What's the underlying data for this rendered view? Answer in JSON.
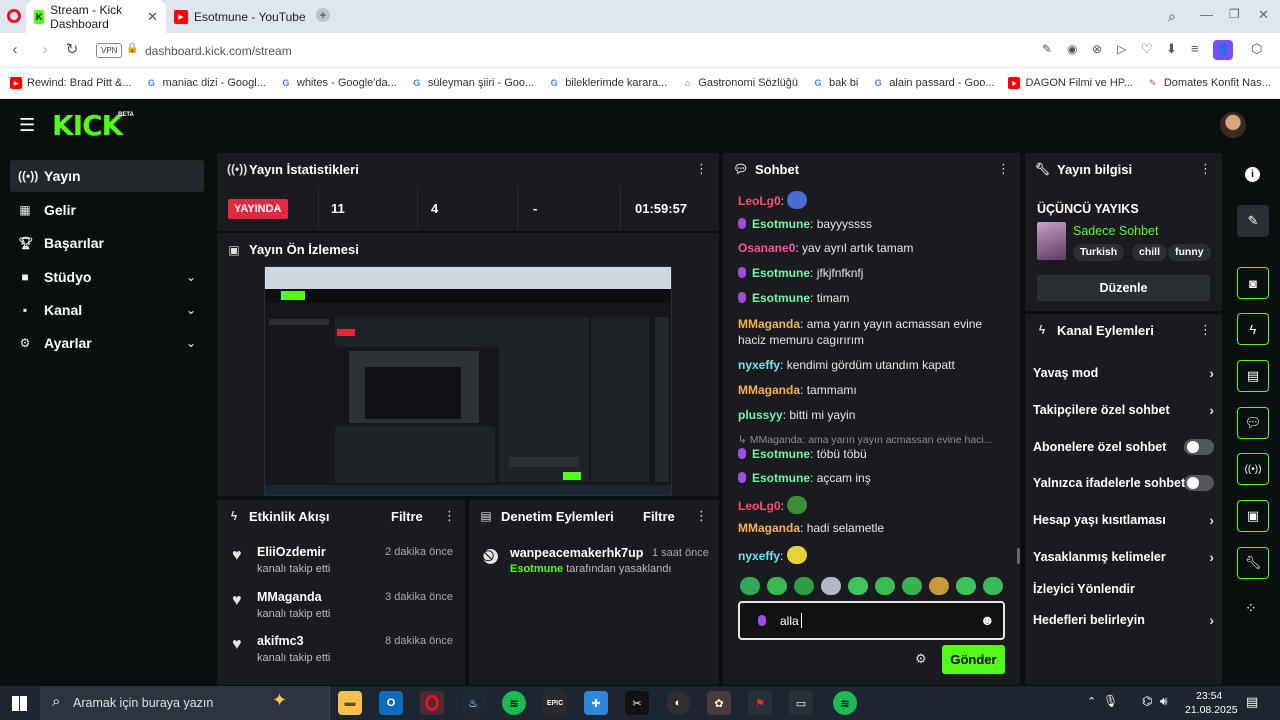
{
  "browser": {
    "tabs": [
      {
        "label": "Stream - Kick Dashboard",
        "active": true
      },
      {
        "label": "Esotmune - YouTube",
        "active": false
      }
    ],
    "url_vpn": "VPN",
    "url": "dashboard.kick.com/stream",
    "bookmarks": [
      {
        "label": "Rewind: Brad Pitt &..."
      },
      {
        "label": "maniac dizi - Googl..."
      },
      {
        "label": "whites - Google'da..."
      },
      {
        "label": "süleyman şiiri - Goo..."
      },
      {
        "label": "bileklerimde karara..."
      },
      {
        "label": "Gastronomi Sözlüğü"
      },
      {
        "label": "bak bi"
      },
      {
        "label": "alain passard - Goo..."
      },
      {
        "label": "DAGON Filmi ve HP..."
      },
      {
        "label": "Domates Konfit Nas..."
      }
    ]
  },
  "kick": {
    "logo": "KICK",
    "beta": "BETA",
    "sidebar": [
      {
        "label": "Yayın",
        "icon": "broadcast-icon",
        "active": true,
        "chevron": false
      },
      {
        "label": "Gelir",
        "icon": "chart-icon",
        "active": false,
        "chevron": false
      },
      {
        "label": "Başarılar",
        "icon": "trophy-icon",
        "active": false,
        "chevron": false
      },
      {
        "label": "Stüdyo",
        "icon": "camera-icon",
        "active": false,
        "chevron": true
      },
      {
        "label": "Kanal",
        "icon": "channel-icon",
        "active": false,
        "chevron": true
      },
      {
        "label": "Ayarlar",
        "icon": "gear-icon",
        "active": false,
        "chevron": true
      }
    ],
    "stats": {
      "title": "Yayın İstatistikleri",
      "live_badge": "YAYINDA",
      "viewers": "11",
      "followers": "4",
      "subs": "-",
      "duration": "01:59:57"
    },
    "preview": {
      "title": "Yayın Ön İzlemesi"
    },
    "activity": {
      "title": "Etkinlik Akışı",
      "filter": "Filtre",
      "items": [
        {
          "user": "EliiOzdemir",
          "time": "2 dakika önce",
          "action": "kanalı takip etti"
        },
        {
          "user": "MMaganda",
          "time": "3 dakika önce",
          "action": "kanalı takip etti"
        },
        {
          "user": "akifmc3",
          "time": "8 dakika önce",
          "action": "kanalı takip etti"
        }
      ]
    },
    "moderation": {
      "title": "Denetim Eylemleri",
      "filter": "Filtre",
      "items": [
        {
          "user": "wanpeacemakerhk7up",
          "time": "1 saat önce",
          "by": "Esotmune",
          "action": "tarafından yasaklandı"
        }
      ]
    },
    "chat": {
      "title": "Sohbet",
      "messages": [
        {
          "user": "LeoLg0",
          "color": "#ff4d6d",
          "text": "",
          "emote": "#4a6cd4",
          "badge": false
        },
        {
          "user": "Esotmune",
          "color": "#72f5a6",
          "text": "bayyyssss",
          "badge": true
        },
        {
          "user": "Osanane0",
          "color": "#ff4fa3",
          "text": "yav ayrıl artık tamam",
          "badge": false
        },
        {
          "user": "Esotmune",
          "color": "#72f5a6",
          "text": "jfkjfnfknfj",
          "badge": true
        },
        {
          "user": "Esotmune",
          "color": "#72f5a6",
          "text": "timam",
          "badge": true
        },
        {
          "user": "MMaganda",
          "color": "#f5b24d",
          "text": "ama yarın yayın acmassan evine haciz memuru cagırırım",
          "badge": false
        },
        {
          "user": "nyxeffy",
          "color": "#6fe3f5",
          "text": "kendimi gördüm utandım kapatt",
          "badge": false
        },
        {
          "user": "MMaganda",
          "color": "#f5b24d",
          "text": "tammamı",
          "badge": false
        },
        {
          "user": "plussyy",
          "color": "#6ff5a8",
          "text": "bitti mi yayin",
          "badge": false
        },
        {
          "reply": "MMaganda: ama yarın yayın acmassan evine haci..."
        },
        {
          "user": "Esotmune",
          "color": "#72f5a6",
          "text": "töbü töbü",
          "badge": true
        },
        {
          "user": "Esotmune",
          "color": "#72f5a6",
          "text": "açcam inş",
          "badge": true
        },
        {
          "user": "LeoLg0",
          "color": "#ff4d6d",
          "text": "",
          "emote": "#3d8c3a",
          "badge": false
        },
        {
          "user": "MMaganda",
          "color": "#f5b24d",
          "text": "hadi selametle",
          "badge": false
        },
        {
          "user": "nyxeffy",
          "color": "#6fe3f5",
          "text": "",
          "emote": "#e6d23a",
          "badge": false
        }
      ],
      "input_value": "alla",
      "send": "Gönder"
    },
    "stream_info": {
      "title": "Yayın bilgisi",
      "stream_title": "ÜÇÜNCÜ YAYIKS",
      "category": "Sadece Sohbet",
      "tags": [
        "Turkish",
        "chill",
        "funny"
      ],
      "edit": "Düzenle"
    },
    "channel_actions": {
      "title": "Kanal Eylemleri",
      "items": [
        {
          "label": "Yavaş mod",
          "type": "chevron"
        },
        {
          "label": "Takipçilere özel sohbet",
          "type": "chevron"
        },
        {
          "label": "Abonelere özel sohbet",
          "type": "toggle"
        },
        {
          "label": "Yalnızca ifadelerle sohbet",
          "type": "toggle"
        },
        {
          "label": "Hesap yaşı kısıtlaması",
          "type": "chevron"
        },
        {
          "label": "Yasaklanmış kelimeler",
          "type": "chevron"
        },
        {
          "label": "İzleyici Yönlendir",
          "type": "none"
        },
        {
          "label": "Hedefleri belirleyin",
          "type": "chevron"
        }
      ]
    }
  },
  "taskbar": {
    "search_placeholder": "Aramak için buraya yazın",
    "time": "23:54",
    "date": "21.08.2025"
  },
  "colors": {
    "kick_green": "#53fc18",
    "panel": "#191b1f",
    "bg": "#0b0e0f",
    "live_red": "#e2293f"
  }
}
